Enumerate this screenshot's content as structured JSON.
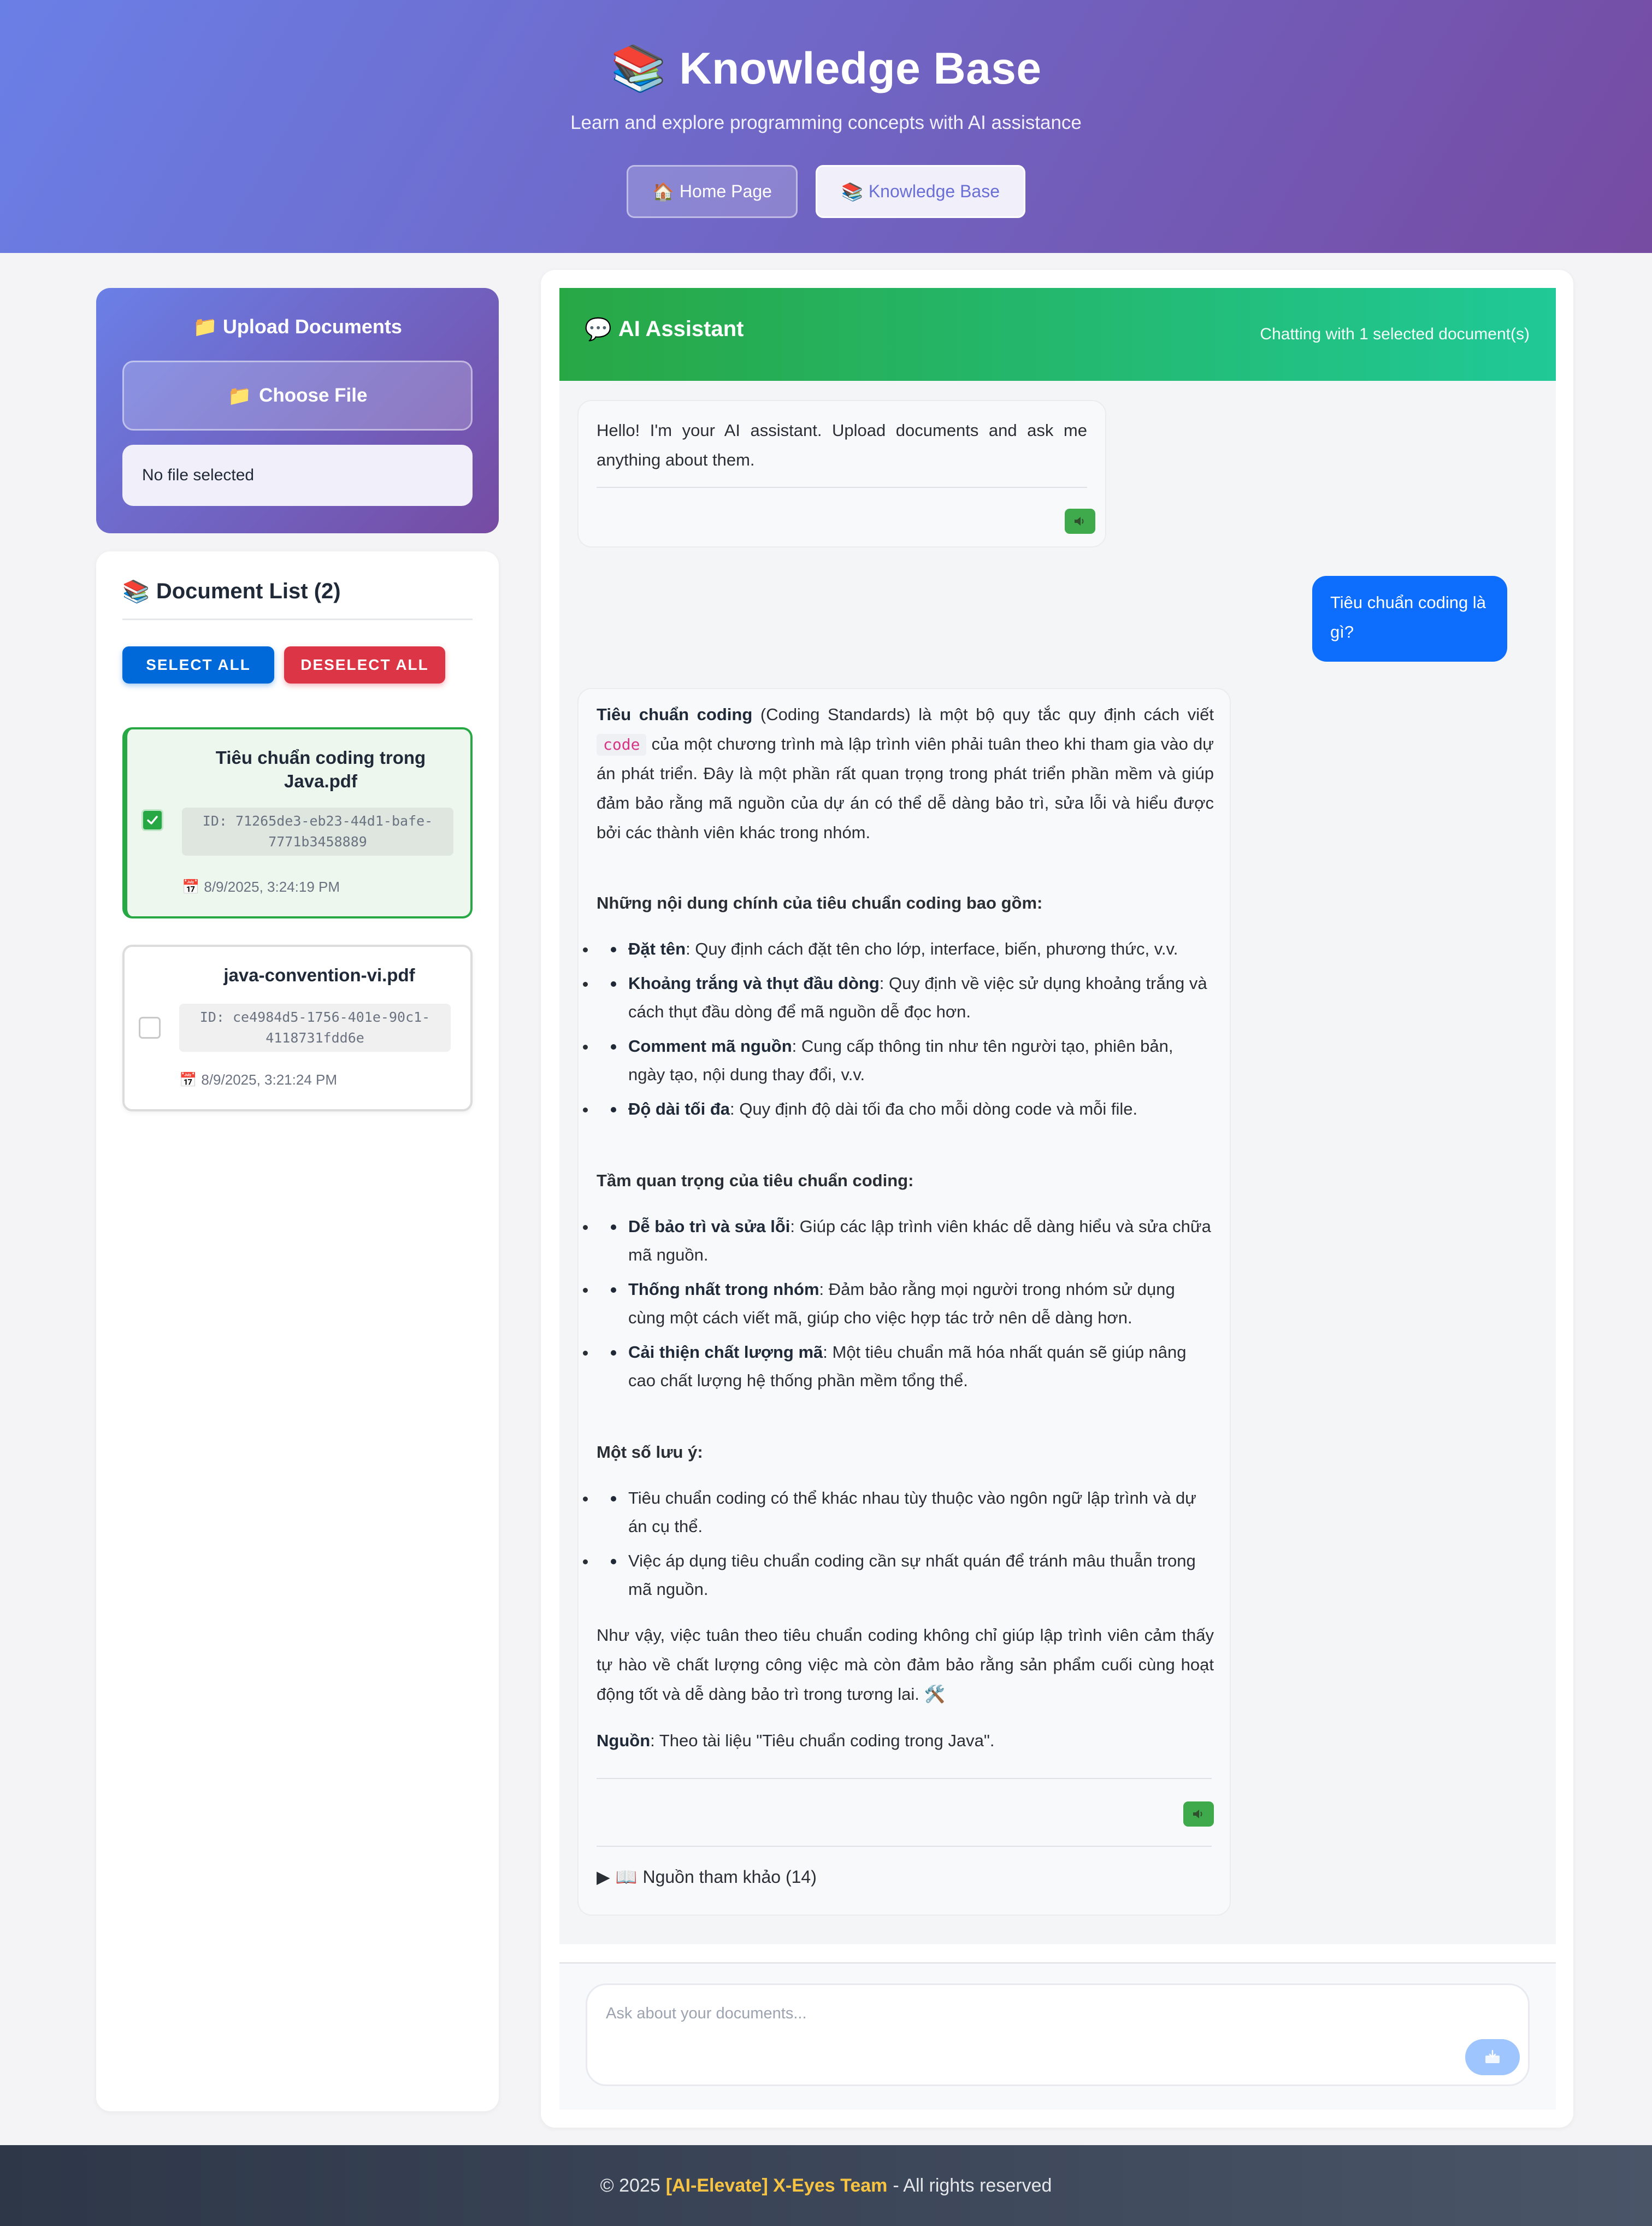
{
  "header": {
    "title": "Knowledge Base",
    "title_icon": "books-icon",
    "subtitle": "Learn and explore programming concepts with AI assistance",
    "nav": [
      {
        "label": "Home Page",
        "icon": "house-icon",
        "active": false
      },
      {
        "label": "Knowledge Base",
        "icon": "books-icon",
        "active": true
      }
    ]
  },
  "upload": {
    "title": "Upload Documents",
    "choose_label": "Choose File",
    "file_status": "No file selected"
  },
  "documents": {
    "title": "Document List (2)",
    "select_all": "SELECT ALL",
    "deselect_all": "DESELECT ALL",
    "items": [
      {
        "name": "Tiêu chuẩn coding trong Java.pdf",
        "id": "ID: 71265de3-eb23-44d1-bafe-7771b3458889",
        "date": "8/9/2025, 3:24:19 PM",
        "selected": true
      },
      {
        "name": "java-convention-vi.pdf",
        "id": "ID: ce4984d5-1756-401e-90c1-4118731fdd6e",
        "date": "8/9/2025, 3:21:24 PM",
        "selected": false
      }
    ]
  },
  "chat": {
    "title": "AI Assistant",
    "status": "Chatting with 1 selected document(s)",
    "greeting": "Hello! I'm your AI assistant. Upload documents and ask me anything about them.",
    "user_message": "Tiêu chuẩn coding là gì?",
    "answer": {
      "intro_bold": "Tiêu chuẩn coding",
      "intro_a": " (Coding Standards) là một bộ quy tắc quy định cách viết ",
      "intro_code": "code",
      "intro_b": " của một chương trình mà lập trình viên phải tuân theo khi tham gia vào dự án phát triển. Đây là một phần rất quan trọng trong phát triển phần mềm và giúp đảm bảo rằng mã nguồn của dự án có thể dễ dàng bảo trì, sửa lỗi và hiểu được bởi các thành viên khác trong nhóm.",
      "h1": "Những nội dung chính của tiêu chuẩn coding bao gồm:",
      "list1": [
        {
          "bold": "Đặt tên",
          "text": ": Quy định cách đặt tên cho lớp, interface, biến, phương thức, v.v."
        },
        {
          "bold": "Khoảng trắng và thụt đầu dòng",
          "text": ": Quy định về việc sử dụng khoảng trắng và cách thụt đầu dòng để mã nguồn dễ đọc hơn."
        },
        {
          "bold": "Comment mã nguồn",
          "text": ": Cung cấp thông tin như tên người tạo, phiên bản, ngày tạo, nội dung thay đổi, v.v."
        },
        {
          "bold": "Độ dài tối đa",
          "text": ": Quy định độ dài tối đa cho mỗi dòng code và mỗi file."
        }
      ],
      "h2": "Tầm quan trọng của tiêu chuẩn coding:",
      "list2": [
        {
          "bold": "Dễ bảo trì và sửa lỗi",
          "text": ": Giúp các lập trình viên khác dễ dàng hiểu và sửa chữa mã nguồn."
        },
        {
          "bold": "Thống nhất trong nhóm",
          "text": ": Đảm bảo rằng mọi người trong nhóm sử dụng cùng một cách viết mã, giúp cho việc hợp tác trở nên dễ dàng hơn."
        },
        {
          "bold": "Cải thiện chất lượng mã",
          "text": ": Một tiêu chuẩn mã hóa nhất quán sẽ giúp nâng cao chất lượng hệ thống phần mềm tổng thể."
        }
      ],
      "h3": "Một số lưu ý:",
      "list3": [
        "Tiêu chuẩn coding có thể khác nhau tùy thuộc vào ngôn ngữ lập trình và dự án cụ thể.",
        "Việc áp dụng tiêu chuẩn coding cần sự nhất quán để tránh mâu thuẫn trong mã nguồn."
      ],
      "conclusion": "Như vậy, việc tuân theo tiêu chuẩn coding không chỉ giúp lập trình viên cảm thấy tự hào về chất lượng công việc mà còn đảm bảo rằng sản phẩm cuối cùng hoạt động tốt và dễ dàng bảo trì trong tương lai. 🛠️",
      "source_bold": "Nguồn",
      "source_text": ": Theo tài liệu \"Tiêu chuẩn coding trong Java\".",
      "references": "Nguồn tham khảo (14)"
    },
    "input_placeholder": "Ask about your documents..."
  },
  "footer": {
    "copyright": "© 2025",
    "brand": "[AI-Elevate] X-Eyes Team",
    "rights": "- All rights reserved"
  },
  "colors": {
    "header_gradient": [
      "#6a7fe6",
      "#764ba2"
    ],
    "chat_header_gradient": [
      "#28a745",
      "#20c997"
    ],
    "user_bubble": "#0d6efd",
    "select_all": "#0069d9",
    "deselect_all": "#dc3545",
    "footer_brand": "#f6c343"
  }
}
